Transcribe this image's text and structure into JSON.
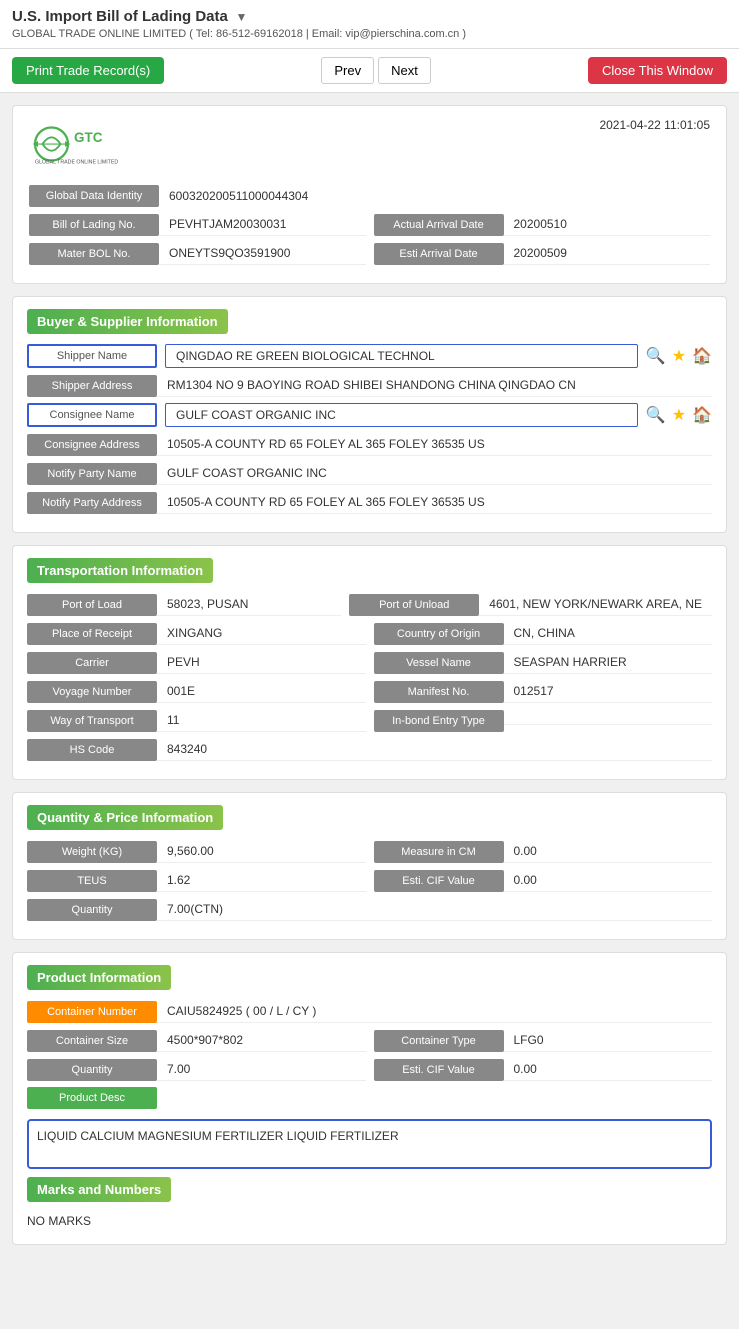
{
  "page": {
    "title": "U.S. Import Bill of Lading Data",
    "title_arrow": "▼",
    "subtitle": "GLOBAL TRADE ONLINE LIMITED ( Tel: 86-512-69162018 | Email: vip@pierschina.com.cn )"
  },
  "toolbar": {
    "print_label": "Print Trade Record(s)",
    "prev_label": "Prev",
    "next_label": "Next",
    "close_label": "Close This Window"
  },
  "record": {
    "timestamp": "2021-04-22 11:01:05",
    "logo_company": "GLOBAL TRADE ONLINE LIMITED",
    "global_data_identity_label": "Global Data Identity",
    "global_data_identity_value": "600320200511000044304",
    "bill_of_lading_label": "Bill of Lading No.",
    "bill_of_lading_value": "PEVHTJAM20030031",
    "actual_arrival_date_label": "Actual Arrival Date",
    "actual_arrival_date_value": "20200510",
    "mater_bol_label": "Mater BOL No.",
    "mater_bol_value": "ONEYTS9QO3591900",
    "esti_arrival_date_label": "Esti Arrival Date",
    "esti_arrival_date_value": "20200509"
  },
  "buyer_supplier": {
    "section_title": "Buyer & Supplier Information",
    "shipper_name_label": "Shipper Name",
    "shipper_name_value": "QINGDAO RE GREEN BIOLOGICAL TECHNOL",
    "shipper_address_label": "Shipper Address",
    "shipper_address_value": "RM1304 NO 9 BAOYING ROAD SHIBEI SHANDONG CHINA QINGDAO CN",
    "consignee_name_label": "Consignee Name",
    "consignee_name_value": "GULF COAST ORGANIC INC",
    "consignee_address_label": "Consignee Address",
    "consignee_address_value": "10505-A COUNTY RD 65 FOLEY AL 365 FOLEY 36535 US",
    "notify_party_name_label": "Notify Party Name",
    "notify_party_name_value": "GULF COAST ORGANIC INC",
    "notify_party_address_label": "Notify Party Address",
    "notify_party_address_value": "10505-A COUNTY RD 65 FOLEY AL 365 FOLEY 36535 US"
  },
  "transportation": {
    "section_title": "Transportation Information",
    "port_of_load_label": "Port of Load",
    "port_of_load_value": "58023, PUSAN",
    "port_of_unload_label": "Port of Unload",
    "port_of_unload_value": "4601, NEW YORK/NEWARK AREA, NE",
    "place_of_receipt_label": "Place of Receipt",
    "place_of_receipt_value": "XINGANG",
    "country_of_origin_label": "Country of Origin",
    "country_of_origin_value": "CN, CHINA",
    "carrier_label": "Carrier",
    "carrier_value": "PEVH",
    "vessel_name_label": "Vessel Name",
    "vessel_name_value": "SEASPAN HARRIER",
    "voyage_number_label": "Voyage Number",
    "voyage_number_value": "001E",
    "manifest_no_label": "Manifest No.",
    "manifest_no_value": "012517",
    "way_of_transport_label": "Way of Transport",
    "way_of_transport_value": "11",
    "in_bond_entry_label": "In-bond Entry Type",
    "in_bond_entry_value": "",
    "hs_code_label": "HS Code",
    "hs_code_value": "843240"
  },
  "quantity_price": {
    "section_title": "Quantity & Price Information",
    "weight_label": "Weight (KG)",
    "weight_value": "9,560.00",
    "measure_in_cm_label": "Measure in CM",
    "measure_in_cm_value": "0.00",
    "teus_label": "TEUS",
    "teus_value": "1.62",
    "esti_cif_value_label": "Esti. CIF Value",
    "esti_cif_value_value": "0.00",
    "quantity_label": "Quantity",
    "quantity_value": "7.00(CTN)"
  },
  "product_info": {
    "section_title": "Product Information",
    "container_number_label": "Container Number",
    "container_number_value": "CAIU5824925 ( 00 / L / CY )",
    "container_size_label": "Container Size",
    "container_size_value": "4500*907*802",
    "container_type_label": "Container Type",
    "container_type_value": "LFG0",
    "quantity_label": "Quantity",
    "quantity_value": "7.00",
    "esti_cif_label": "Esti. CIF Value",
    "esti_cif_value": "0.00",
    "product_desc_label": "Product Desc",
    "product_desc_value": "LIQUID CALCIUM MAGNESIUM FERTILIZER LIQUID FERTILIZER",
    "marks_and_numbers_label": "Marks and Numbers",
    "marks_value": "NO MARKS"
  },
  "icons": {
    "search": "🔍",
    "star": "★",
    "home": "🏠",
    "dropdown": "▼"
  }
}
